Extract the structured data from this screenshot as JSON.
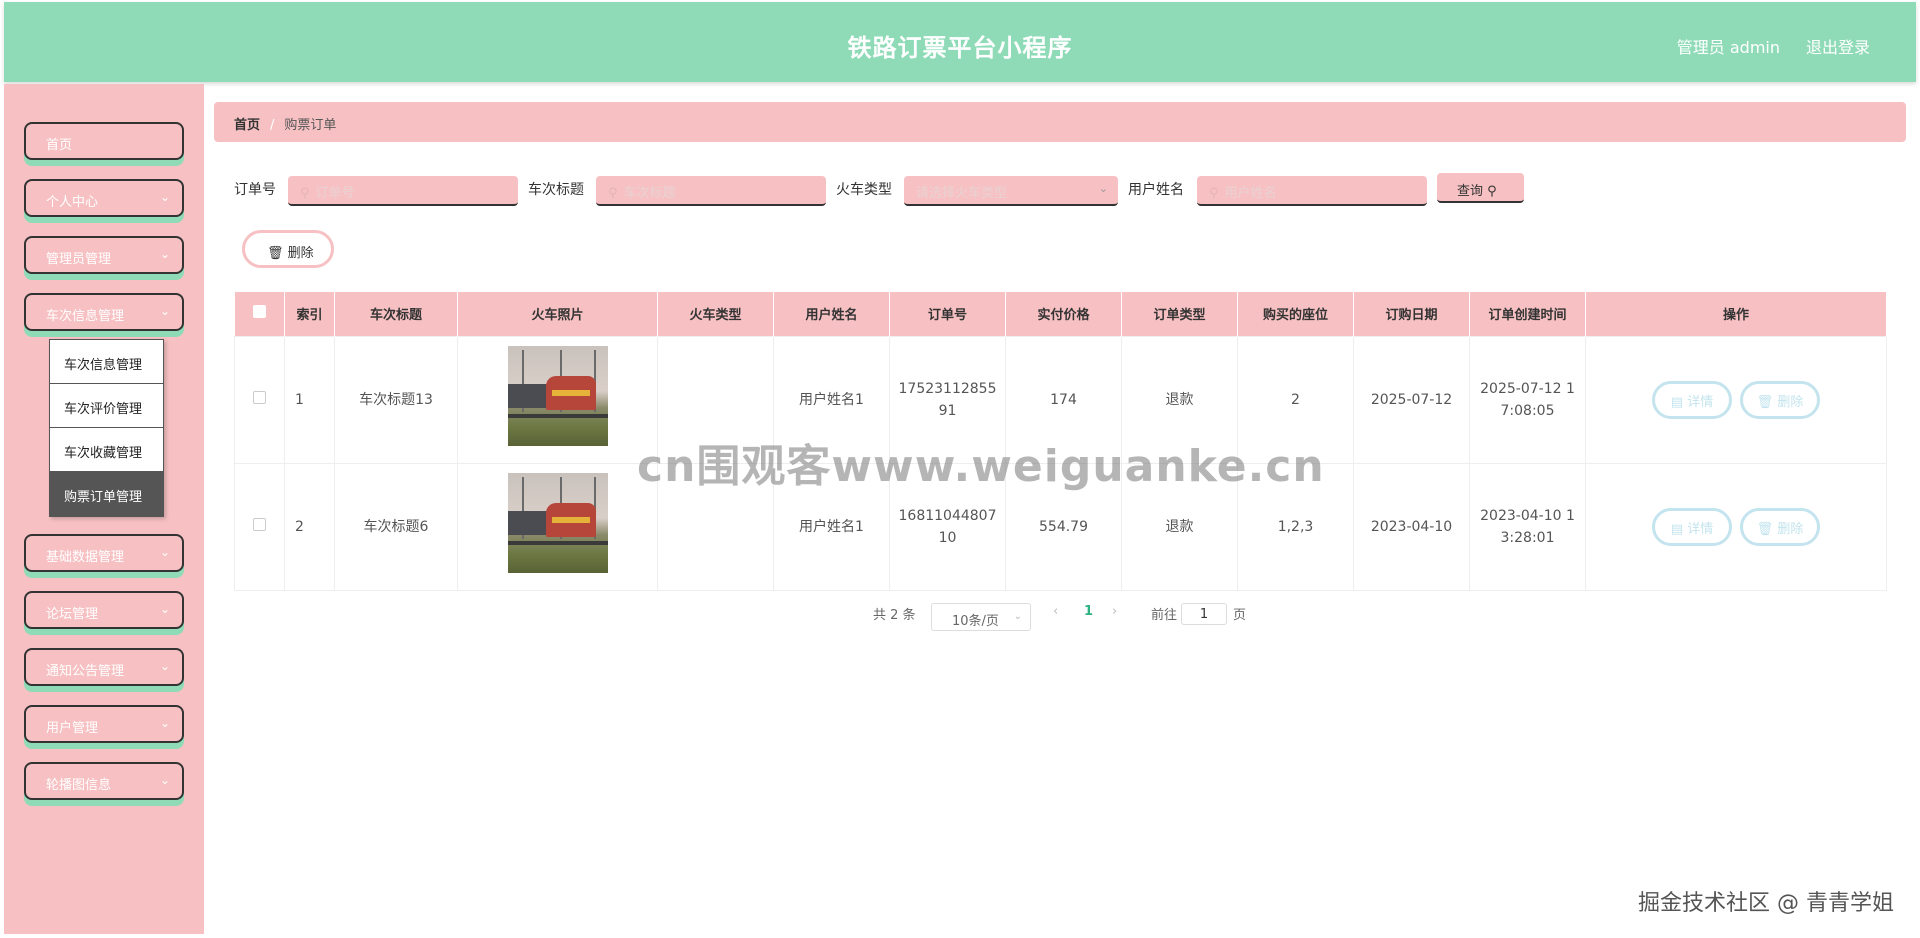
{
  "header": {
    "title": "铁路订票平台小程序",
    "admin_label": "管理员 admin",
    "logout_label": "退出登录"
  },
  "sidebar": {
    "items": [
      {
        "label": "首页",
        "has_arrow": false
      },
      {
        "label": "个人中心",
        "has_arrow": true
      },
      {
        "label": "管理员管理",
        "has_arrow": true
      },
      {
        "label": "车次信息管理",
        "has_arrow": true
      },
      {
        "label": "基础数据管理",
        "has_arrow": true
      },
      {
        "label": "论坛管理",
        "has_arrow": true
      },
      {
        "label": "通知公告管理",
        "has_arrow": true
      },
      {
        "label": "用户管理",
        "has_arrow": true
      },
      {
        "label": "轮播图信息",
        "has_arrow": true
      }
    ],
    "submenu": [
      {
        "label": "车次信息管理",
        "active": false
      },
      {
        "label": "车次评价管理",
        "active": false
      },
      {
        "label": "车次收藏管理",
        "active": false
      },
      {
        "label": "购票订单管理",
        "active": true
      }
    ]
  },
  "breadcrumb": {
    "home": "首页",
    "separator": "/",
    "current": "购票订单"
  },
  "search": {
    "order_no_label": "订单号",
    "order_no_placeholder": "订单号",
    "train_title_label": "车次标题",
    "train_title_placeholder": "车次标题",
    "train_type_label": "火车类型",
    "train_type_placeholder": "请选择火车类型",
    "user_name_label": "用户姓名",
    "user_name_placeholder": "用户姓名",
    "query_label": "查询"
  },
  "toolbar": {
    "delete_label": "删除"
  },
  "table": {
    "columns": [
      "索引",
      "车次标题",
      "火车照片",
      "火车类型",
      "用户姓名",
      "订单号",
      "实付价格",
      "订单类型",
      "购买的座位",
      "订购日期",
      "订单创建时间",
      "操作"
    ],
    "rows": [
      {
        "index": "1",
        "title": "车次标题13",
        "train_type": "",
        "user_name": "用户姓名1",
        "order_no_1": "17523112855",
        "order_no_2": "91",
        "price": "174",
        "order_type": "退款",
        "seats": "2",
        "date": "2025-07-12",
        "created_1": "2025-07-12 1",
        "created_2": "7:08:05"
      },
      {
        "index": "2",
        "title": "车次标题6",
        "train_type": "",
        "user_name": "用户姓名1",
        "order_no_1": "16811044807",
        "order_no_2": "10",
        "price": "554.79",
        "order_type": "退款",
        "seats": "1,2,3",
        "date": "2023-04-10",
        "created_1": "2023-04-10 1",
        "created_2": "3:28:01"
      }
    ],
    "detail_label": "详情",
    "delete_label": "删除"
  },
  "pagination": {
    "total": "共 2 条",
    "page_size": "10条/页",
    "current_page": "1",
    "goto_label": "前往",
    "goto_value": "1",
    "page_suffix": "页"
  },
  "watermarks": {
    "center": "cn围观客www.weiguanke.cn",
    "corner": "掘金技术社区 @ 青青学姐"
  },
  "colors": {
    "header_bg": "#8fdbb7",
    "pink": "#f7c1c3",
    "action_border": "#c3e4ee",
    "submenu_active": "#555555"
  }
}
